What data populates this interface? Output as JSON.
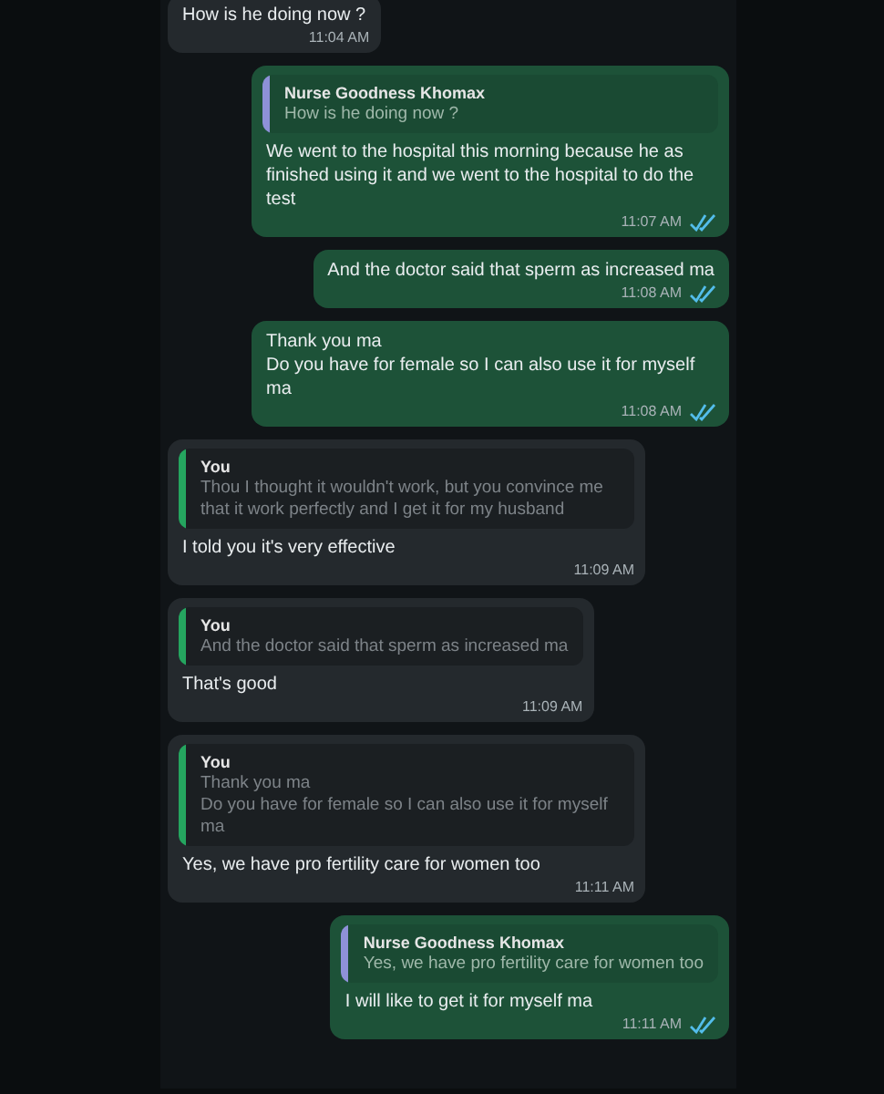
{
  "messages": [
    {
      "kind": "incoming",
      "text": "How is he doing now ?",
      "time": "11:04 AM"
    },
    {
      "kind": "outgoing",
      "quote": {
        "author": "Nurse Goodness Khomax",
        "text": "How is he doing now ?",
        "color": "#8e91d8"
      },
      "text": "We went to the hospital this morning because he as finished using it and we went to the hospital to do the test",
      "time": "11:07 AM",
      "read": true
    },
    {
      "kind": "outgoing",
      "text": "And the doctor said that sperm as increased ma",
      "time": "11:08 AM",
      "read": true
    },
    {
      "kind": "outgoing",
      "text": "Thank you ma\nDo you have for female so I can also use it for myself ma",
      "time": "11:08 AM",
      "read": true
    },
    {
      "kind": "incoming",
      "quote": {
        "author": "You",
        "text": "Thou I thought it wouldn't work, but you convince me that it work perfectly and I get it for my husband",
        "color": "#25a55f"
      },
      "text": "I told you it's very effective",
      "time": "11:09 AM"
    },
    {
      "kind": "incoming",
      "quote": {
        "author": "You",
        "text": "And the doctor said that sperm as increased ma",
        "color": "#25a55f"
      },
      "text": "That's good",
      "time": "11:09 AM"
    },
    {
      "kind": "incoming",
      "quote": {
        "author": "You",
        "text": "Thank you ma\nDo you have for female so I can also use it for myself ma",
        "color": "#25a55f"
      },
      "text": "Yes, we have pro fertility care for women too",
      "time": "11:11 AM"
    },
    {
      "kind": "outgoing",
      "quote": {
        "author": "Nurse Goodness Khomax",
        "text": "Yes, we have pro fertility care for women too",
        "color": "#8e91d8"
      },
      "text": "I will like to get it for myself ma",
      "time": "11:11 AM",
      "read": true
    }
  ]
}
